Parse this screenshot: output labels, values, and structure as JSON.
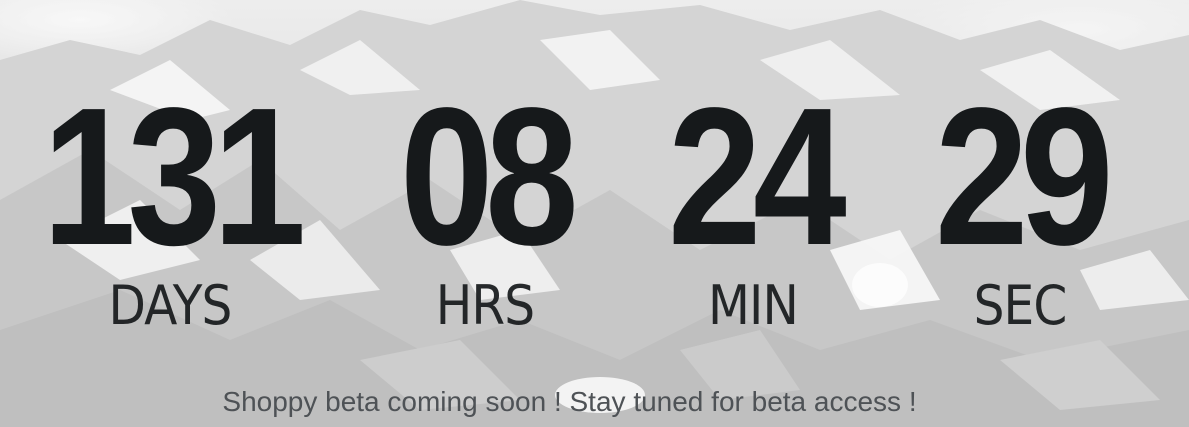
{
  "countdown": {
    "days": {
      "value": "131",
      "label": "DAYS"
    },
    "hours": {
      "value": "08",
      "label": "HRS"
    },
    "minutes": {
      "value": "24",
      "label": "MIN"
    },
    "seconds": {
      "value": "29",
      "label": "SEC"
    }
  },
  "message": "Shoppy beta coming soon ! Stay tuned for beta access !",
  "colors": {
    "digits": "#16191b",
    "message": "#4e5256",
    "background": "#d4d4d4"
  }
}
